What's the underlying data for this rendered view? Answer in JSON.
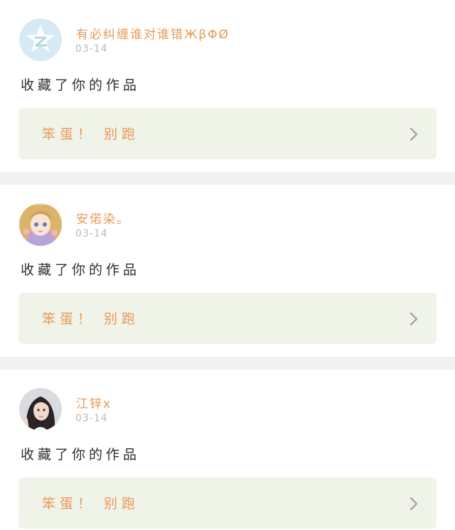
{
  "feed": {
    "items": [
      {
        "username": "有必纠缠谁对谁错ЖβΦØ",
        "time": "03-14",
        "action": "收藏了你的作品",
        "work_title": "笨蛋！ 别跑",
        "avatar_icon": "qzone-star-avatar-icon"
      },
      {
        "username": "安偌染。",
        "time": "03-14",
        "action": "收藏了你的作品",
        "work_title": "笨蛋！ 别跑",
        "avatar_icon": "anime-girl-avatar-icon"
      },
      {
        "username": "江锌x",
        "time": "03-14",
        "action": "收藏了你的作品",
        "work_title": "笨蛋！ 别跑",
        "avatar_icon": "photo-girl-avatar-icon"
      }
    ]
  },
  "colors": {
    "accent": "#e79a58",
    "time_gray": "#b9b9b9",
    "work_box_bg": "#f0f3e8",
    "separator": "#f1f1f1"
  }
}
